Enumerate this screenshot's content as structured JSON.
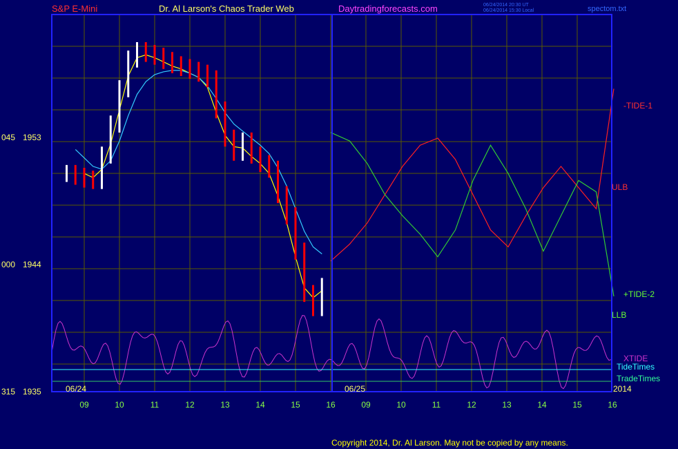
{
  "header": {
    "instrument": "S&P E-Mini",
    "site_name": "Dr. Al Larson's Chaos Trader Web",
    "site_url": "Daytradingforecasts.com",
    "timestamp_ut": "06/24/2014 20:30 UT",
    "timestamp_local": "06/24/2014 15:30 Local",
    "file_name": "spectom.txt"
  },
  "footer": {
    "copyright": "Copyright 2014, Dr. Al Larson. May not be copied by any means."
  },
  "colors": {
    "background": "#000066",
    "frame": "#2222ff",
    "grid": "#5a5a00",
    "price_down": "#ff0000",
    "price_up": "#ffffff",
    "ma_yellow": "#ffff00",
    "ma_cyan": "#33ccff",
    "band_red": "#ff2020",
    "band_green": "#33cc33",
    "xtide": "#cc33cc",
    "tide_times": "#33ffff",
    "trade_times": "#33cc66"
  },
  "chart_data": {
    "type": "line",
    "title": "S&P E-Mini",
    "y_ticks": [
      {
        "left": "045",
        "price": "1953"
      },
      {
        "left": "000",
        "price": "1944"
      },
      {
        "left": "315",
        "price": "1935"
      }
    ],
    "ylim": [
      1935,
      1956
    ],
    "x_ticks": [
      "09",
      "10",
      "11",
      "12",
      "13",
      "14",
      "15",
      "16",
      "09",
      "10",
      "11",
      "12",
      "13",
      "14",
      "15",
      "16"
    ],
    "date_labels": [
      "06/24",
      "06/25",
      "2014"
    ],
    "series_labels": {
      "tide1": "-TIDE-1",
      "ulb": "ULB",
      "tide2": "+TIDE-2",
      "llb": "LLB",
      "xtide": "XTIDE",
      "tide_times": "TideTimes",
      "trade_times": "TradeTimes"
    },
    "hours": [
      8.5,
      8.75,
      9,
      9.25,
      9.5,
      9.75,
      10,
      10.25,
      10.5,
      10.75,
      11,
      11.25,
      11.5,
      11.75,
      12,
      12.25,
      12.5,
      12.75,
      13,
      13.25,
      13.5,
      13.75,
      14,
      14.25,
      14.5,
      14.75,
      15,
      15.25,
      15.5,
      15.75
    ],
    "price_close": [
      1950.5,
      1950.3,
      1950.1,
      1950.0,
      1951.8,
      1954.0,
      1956.5,
      1958.6,
      1959.2,
      1959.0,
      1958.8,
      1958.5,
      1958.2,
      1958.0,
      1957.8,
      1957.6,
      1957.2,
      1955.0,
      1953.0,
      1952.0,
      1952.8,
      1951.8,
      1951.2,
      1950.8,
      1949.0,
      1947.5,
      1945.0,
      1942.0,
      1941.0,
      1942.5
    ],
    "ma_fast": [
      null,
      null,
      1950.5,
      1950.2,
      1950.8,
      1952.6,
      1955.0,
      1957.4,
      1958.7,
      1958.9,
      1958.7,
      1958.4,
      1958.1,
      1957.9,
      1957.6,
      1957.3,
      1956.6,
      1954.8,
      1953.2,
      1952.4,
      1952.3,
      1951.7,
      1951.2,
      1950.5,
      1948.9,
      1947.0,
      1944.6,
      1942.4,
      1941.7,
      1942.2
    ],
    "ma_slow": [
      null,
      1952.2,
      1951.6,
      1951.0,
      1950.8,
      1951.4,
      1952.8,
      1954.6,
      1956.1,
      1957.0,
      1957.5,
      1957.7,
      1957.8,
      1957.8,
      1957.6,
      1957.3,
      1956.7,
      1955.8,
      1954.8,
      1954.0,
      1953.5,
      1953.0,
      1952.5,
      1951.9,
      1950.9,
      1949.6,
      1948.0,
      1946.4,
      1945.3,
      1944.8
    ],
    "future_hours": [
      16,
      16.5,
      17,
      17.5,
      18,
      18.5,
      19,
      19.5,
      20,
      20.5,
      21,
      21.5,
      22,
      22.5,
      23,
      23.5,
      24
    ],
    "ulb": [
      1944.3,
      1945.5,
      1947.0,
      1949.0,
      1951.0,
      1952.5,
      1953.0,
      1951.5,
      1949.0,
      1946.5,
      1945.3,
      1947.5,
      1949.5,
      1951.0,
      1949.5,
      1948.0,
      1956.5
    ],
    "llb": [
      1953.4,
      1952.8,
      1951.2,
      1949.0,
      1947.5,
      1946.2,
      1944.6,
      1946.5,
      1950.0,
      1952.5,
      1950.5,
      1948.0,
      1945.0,
      1947.5,
      1950.0,
      1949.2,
      1941.8
    ]
  }
}
